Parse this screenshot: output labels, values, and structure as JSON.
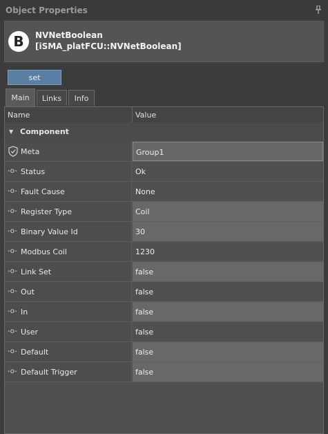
{
  "window": {
    "title": "Object Properties",
    "pin_icon": "pin-icon"
  },
  "object": {
    "badge": "B",
    "name": "NVNetBoolean",
    "type": "[iSMA_platFCU::NVNetBoolean]"
  },
  "action": {
    "set_label": "set"
  },
  "tabs": [
    {
      "label": "Main",
      "active": true
    },
    {
      "label": "Links"
    },
    {
      "label": "Info"
    }
  ],
  "columns": {
    "name": "Name",
    "value": "Value"
  },
  "section": {
    "label": "Component"
  },
  "rows": [
    {
      "name": "Meta",
      "icon": "shield-icon",
      "value": "Group1"
    },
    {
      "name": "Status",
      "icon": "slot-icon",
      "value": "Ok"
    },
    {
      "name": "Fault Cause",
      "icon": "slot-icon",
      "value": "None"
    },
    {
      "name": "Register Type",
      "icon": "slot-icon",
      "value": "Coil"
    },
    {
      "name": "Binary Value Id",
      "icon": "slot-icon",
      "value": "30"
    },
    {
      "name": "Modbus Coil",
      "icon": "slot-icon",
      "value": "1230"
    },
    {
      "name": "Link Set",
      "icon": "slot-icon",
      "value": "false"
    },
    {
      "name": "Out",
      "icon": "slot-icon",
      "value": "false"
    },
    {
      "name": "In",
      "icon": "slot-icon",
      "value": "false"
    },
    {
      "name": "User",
      "icon": "slot-icon",
      "value": "false"
    },
    {
      "name": "Default",
      "icon": "slot-icon",
      "value": "false"
    },
    {
      "name": "Default Trigger",
      "icon": "slot-icon",
      "value": "false"
    }
  ],
  "colors": {
    "accent": "#5b7fa3",
    "panel": "#3c3c3c"
  }
}
